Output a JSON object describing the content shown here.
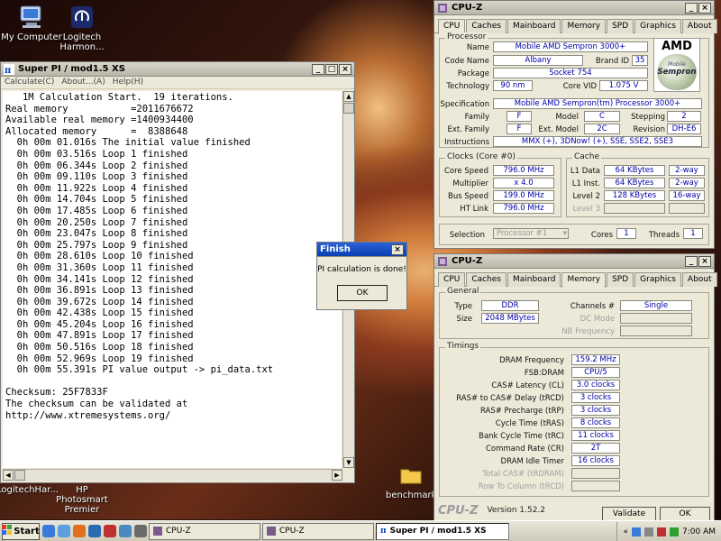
{
  "desktop": {
    "icons": [
      {
        "label": "My Computer"
      },
      {
        "label": "Logitech Harmon..."
      },
      {
        "label": "LogitechHar..."
      },
      {
        "label": "HP Photosmart Premier"
      },
      {
        "label": "benchmarks"
      }
    ]
  },
  "superpi": {
    "title": "Super PI / mod1.5 XS",
    "menu": [
      "Calculate(C)",
      "About...(A)",
      "Help(H)"
    ],
    "lines": [
      "   1M Calculation Start.  19 iterations.",
      "Real memory           =2011676672",
      "Available real memory =1400934400",
      "Allocated memory      =  8388648",
      "  0h 00m 01.016s The initial value finished",
      "  0h 00m 03.516s Loop 1 finished",
      "  0h 00m 06.344s Loop 2 finished",
      "  0h 00m 09.110s Loop 3 finished",
      "  0h 00m 11.922s Loop 4 finished",
      "  0h 00m 14.704s Loop 5 finished",
      "  0h 00m 17.485s Loop 6 finished",
      "  0h 00m 20.250s Loop 7 finished",
      "  0h 00m 23.047s Loop 8 finished",
      "  0h 00m 25.797s Loop 9 finished",
      "  0h 00m 28.610s Loop 10 finished",
      "  0h 00m 31.360s Loop 11 finished",
      "  0h 00m 34.141s Loop 12 finished",
      "  0h 00m 36.891s Loop 13 finished",
      "  0h 00m 39.672s Loop 14 finished",
      "  0h 00m 42.438s Loop 15 finished",
      "  0h 00m 45.204s Loop 16 finished",
      "  0h 00m 47.891s Loop 17 finished",
      "  0h 00m 50.516s Loop 18 finished",
      "  0h 00m 52.969s Loop 19 finished",
      "  0h 00m 55.391s PI value output -> pi_data.txt",
      "",
      "Checksum: 25F7833F",
      "The checksum can be validated at",
      "http://www.xtremesystems.org/"
    ]
  },
  "finish": {
    "title": "Finish",
    "message": "PI calculation is done!",
    "ok": "OK"
  },
  "cpuz1": {
    "title": "CPU-Z",
    "tabs": [
      "CPU",
      "Caches",
      "Mainboard",
      "Memory",
      "SPD",
      "Graphics",
      "About"
    ],
    "processor_group": "Processor",
    "name_lbl": "Name",
    "name": "Mobile AMD Sempron 3000+",
    "codename_lbl": "Code Name",
    "codename": "Albany",
    "brandid_lbl": "Brand ID",
    "brandid": "35",
    "package_lbl": "Package",
    "package": "Socket 754",
    "tech_lbl": "Technology",
    "tech": "90 nm",
    "corevid_lbl": "Core VID",
    "corevid": "1.075 V",
    "spec_lbl": "Specification",
    "spec": "Mobile AMD Sempron(tm) Processor 3000+",
    "family_lbl": "Family",
    "family": "F",
    "model_lbl": "Model",
    "model": "C",
    "stepping_lbl": "Stepping",
    "stepping": "2",
    "extfamily_lbl": "Ext. Family",
    "extfamily": "F",
    "extmodel_lbl": "Ext. Model",
    "extmodel": "2C",
    "revision_lbl": "Revision",
    "revision": "DH-E6",
    "instr_lbl": "Instructions",
    "instr": "MMX (+), 3DNow! (+), SSE, SSE2, SSE3",
    "logo_brand": "AMD",
    "logo_sub1": "Mobile",
    "logo_sub2": "Sempron",
    "clocks_group": "Clocks (Core #0)",
    "corespeed_lbl": "Core Speed",
    "corespeed": "796.0 MHz",
    "mult_lbl": "Multiplier",
    "mult": "x 4.0",
    "bus_lbl": "Bus Speed",
    "bus": "199.0 MHz",
    "ht_lbl": "HT Link",
    "ht": "796.0 MHz",
    "cache_group": "Cache",
    "l1d_lbl": "L1 Data",
    "l1d": "64 KBytes",
    "l1d_way": "2-way",
    "l1i_lbl": "L1 Inst.",
    "l1i": "64 KBytes",
    "l1i_way": "2-way",
    "l2_lbl": "Level 2",
    "l2": "128 KBytes",
    "l2_way": "16-way",
    "l3_lbl": "Level 3",
    "selection_lbl": "Selection",
    "selection": "Processor #1",
    "cores_lbl": "Cores",
    "cores": "1",
    "threads_lbl": "Threads",
    "threads": "1"
  },
  "cpuz2": {
    "title": "CPU-Z",
    "tabs": [
      "CPU",
      "Caches",
      "Mainboard",
      "Memory",
      "SPD",
      "Graphics",
      "About"
    ],
    "general_group": "General",
    "type_lbl": "Type",
    "type": "DDR",
    "channels_lbl": "Channels #",
    "channels": "Single",
    "size_lbl": "Size",
    "size": "2048 MBytes",
    "dcmode_lbl": "DC Mode",
    "nbfreq_lbl": "NB Frequency",
    "timings_group": "Timings",
    "dramfreq_lbl": "DRAM Frequency",
    "dramfreq": "159.2 MHz",
    "fsb_lbl": "FSB:DRAM",
    "fsb": "CPU/5",
    "cas_lbl": "CAS# Latency (CL)",
    "cas": "3.0 clocks",
    "trcd_lbl": "RAS# to CAS# Delay (tRCD)",
    "trcd": "3 clocks",
    "trp_lbl": "RAS# Precharge (tRP)",
    "trp": "3 clocks",
    "tras_lbl": "Cycle Time (tRAS)",
    "tras": "8 clocks",
    "trc_lbl": "Bank Cycle Time (tRC)",
    "trc": "11 clocks",
    "cr_lbl": "Command Rate (CR)",
    "cr": "2T",
    "idle_lbl": "DRAM Idle Timer",
    "idle": "16 clocks",
    "totalcas_lbl": "Total CAS# (tRDRAM)",
    "rowcol_lbl": "Row To Column (tRCD)",
    "brand": "CPU-Z",
    "version": "Version 1.52.2",
    "validate": "Validate",
    "ok": "OK"
  },
  "taskbar": {
    "start": "Start",
    "tasks": [
      "CPU-Z",
      "CPU-Z",
      "Super PI / mod1.5 XS"
    ],
    "tray_arrows": "«",
    "clock": "7:00 AM"
  }
}
